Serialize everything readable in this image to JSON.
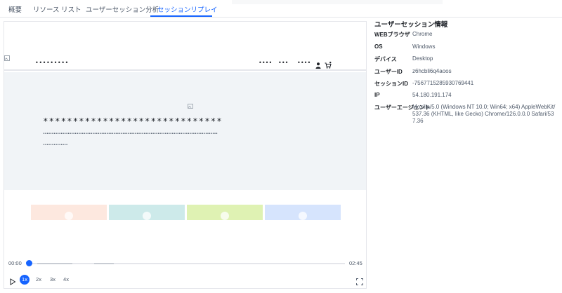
{
  "tabs": [
    {
      "label": "概要"
    },
    {
      "label": "リソース リスト"
    },
    {
      "label": "ユーザーセッション分析"
    },
    {
      "label": "セッションリプレイ"
    }
  ],
  "active_tab": "セッションリプレイ",
  "replay": {
    "site_logo": "•••••••••",
    "nav_items": [
      "••••",
      "•••",
      "••••"
    ],
    "hero_title": "******************************",
    "hero_subtitle": "•••••••••••••••••••••••••••••••••••••••••••••••••••••••••••••••••••••••••••••••••••••••••••••••••••",
    "hero_button": "••••••••••••••",
    "cards": [
      {
        "color": "#fde8df"
      },
      {
        "color": "#cdeaea"
      },
      {
        "color": "#dff2b3"
      },
      {
        "color": "#d6e4fd"
      }
    ],
    "icons": [
      "broken-image-icon",
      "user-icon",
      "cart-icon"
    ]
  },
  "player": {
    "current_time": "00:00",
    "total_time": "02:45",
    "progress": 0,
    "speeds": [
      "1x",
      "2x",
      "3x",
      "4x"
    ],
    "active_speed": "1x",
    "accent_color": "#1664ff"
  },
  "session_info": {
    "title": "ユーザーセッション情報",
    "rows": [
      {
        "key": "WEBブラウザ",
        "value": "Chrome"
      },
      {
        "key": "OS",
        "value": "Windows"
      },
      {
        "key": "デバイス",
        "value": "Desktop"
      },
      {
        "key": "ユーザーID",
        "value": "z6hcbli6q4aoos"
      },
      {
        "key": "セッションID",
        "value": "-7567715285930769441"
      },
      {
        "key": "IP",
        "value": "54.180.191.174"
      },
      {
        "key": "ユーザーエージェント",
        "value": "Mozilla/5.0 (Windows NT 10.0; Win64; x64) AppleWebKit/537.36 (KHTML, like Gecko) Chrome/126.0.0.0 Safari/537.36"
      }
    ]
  }
}
